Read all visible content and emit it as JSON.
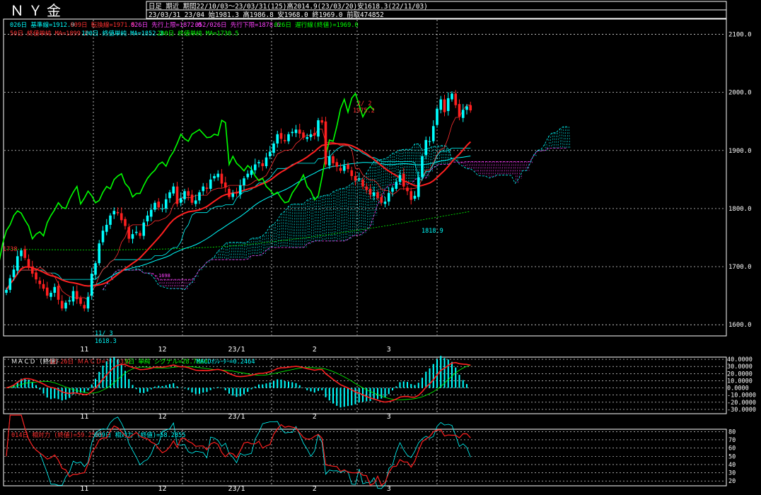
{
  "header": {
    "symbol": "ＮＹ金",
    "line1": "日足 期近 期間22/10/03～23/03/31(125)高2014.9(23/03/20)安1618.3(22/11/03)",
    "line2": "23/03/31 23/04 始1981.3 高1986.8 安1968.0 終1969.0 前取474852"
  },
  "legend": {
    "row1": [
      {
        "text": "026日 基準線=1912.9",
        "color": "#00ffff"
      },
      {
        "text": "009日 転換線=1971.5",
        "color": "#ff3030"
      },
      {
        "text": "026日 先行上限=1872.0",
        "color": "#ff40ff"
      },
      {
        "text": "052/026日 先行下限=1878.6",
        "color": "#ff40ff"
      },
      {
        "text": "026日 遅行線(終値)=1969.0",
        "color": "#00ff00"
      }
    ],
    "row2": [
      {
        "text": "50日 終値単純 MA=1899.2",
        "color": "#ff3030"
      },
      {
        "text": "100日 終値単純 MA=1852.3",
        "color": "#00ffff"
      },
      {
        "text": "200日 終値単純 MA=1730.5",
        "color": "#00ff00"
      }
    ]
  },
  "annotations": {
    "high_date": "2/ 2",
    "high_value": "1975.2",
    "low_date": "11/ 3",
    "low_value": "1618.3",
    "mid_low": "1818.9",
    "left_value": "1738",
    "left_small": "1698"
  },
  "macd_legend": [
    {
      "text": "ＭＡＣＤ (終値)",
      "color": "#ffffff"
    },
    {
      "text": "12-26日 ＭＡＣＤ=29.0332",
      "color": "#ff3030"
    },
    {
      "text": "9日 単純 シグナル=28.7868",
      "color": "#00ff00"
    },
    {
      "text": "MACDｵｼﾚｰﾀｰ=0.2464",
      "color": "#00ffff"
    }
  ],
  "rsi_legend": [
    {
      "text": "014日 相対力 (終値)=59.2565",
      "color": "#ff3030"
    },
    {
      "text": "009日 相対力 (終値)=58.2855",
      "color": "#00ffff"
    }
  ],
  "x_axis_labels": [
    {
      "label": "11",
      "index": 21
    },
    {
      "label": "12",
      "index": 42
    },
    {
      "label": "23/1",
      "index": 62
    },
    {
      "label": "2",
      "index": 83
    },
    {
      "label": "3",
      "index": 103
    }
  ],
  "price_axis": {
    "ticks": [
      1600,
      1700,
      1800,
      1900,
      2000,
      2100
    ],
    "labels": [
      "1600.0",
      "1700.0",
      "1800.0",
      "1900.0",
      "2000.0",
      "2100.0"
    ],
    "min": 1582,
    "max": 2125
  },
  "macd_axis": {
    "ticks": [
      40,
      30,
      20,
      10,
      0,
      -10,
      -20,
      -30
    ],
    "labels": [
      "40.0000",
      "30.0000",
      "20.0000",
      "10.0000",
      "0.0000",
      "-10.0000",
      "-20.0000",
      "-30.0000"
    ],
    "min": -35,
    "max": 42
  },
  "rsi_axis": {
    "ticks": [
      80,
      70,
      60,
      50,
      40,
      30,
      20
    ],
    "labels": [
      "80",
      "70",
      "60",
      "50",
      "40",
      "30",
      "20"
    ],
    "min": 15,
    "max": 82
  },
  "colors": {
    "up": "#00ffff",
    "down": "#ff2020",
    "grid": "#ffffff",
    "kumo_up": "#00ffff",
    "kumo_down": "#ff40ff"
  },
  "chart_data": {
    "type": "candlestick",
    "title": "ＮＹ金 日足",
    "closes": [
      1660,
      1680,
      1695,
      1718,
      1728,
      1715,
      1700,
      1688,
      1678,
      1670,
      1662,
      1650,
      1655,
      1665,
      1643,
      1628,
      1638,
      1642,
      1658,
      1644,
      1636,
      1628,
      1648,
      1688,
      1706,
      1740,
      1762,
      1772,
      1788,
      1796,
      1792,
      1780,
      1770,
      1748,
      1756,
      1760,
      1753,
      1776,
      1788,
      1798,
      1810,
      1802,
      1800,
      1816,
      1828,
      1838,
      1808,
      1818,
      1830,
      1822,
      1810,
      1814,
      1828,
      1838,
      1834,
      1850,
      1856,
      1860,
      1843,
      1836,
      1820,
      1826,
      1826,
      1840,
      1852,
      1860,
      1866,
      1876,
      1880,
      1873,
      1888,
      1898,
      1912,
      1928,
      1920,
      1916,
      1928,
      1932,
      1936,
      1929,
      1922,
      1923,
      1928,
      1926,
      1952,
      1948,
      1876,
      1890,
      1878,
      1872,
      1865,
      1874,
      1868,
      1856,
      1848,
      1852,
      1838,
      1832,
      1824,
      1828,
      1818,
      1810,
      1812,
      1827,
      1836,
      1846,
      1858,
      1838,
      1830,
      1815,
      1822,
      1854,
      1890,
      1918,
      1916,
      1942,
      1972,
      1988,
      1966,
      1990,
      1998,
      1978,
      1958,
      1970,
      1976,
      1969
    ]
  }
}
